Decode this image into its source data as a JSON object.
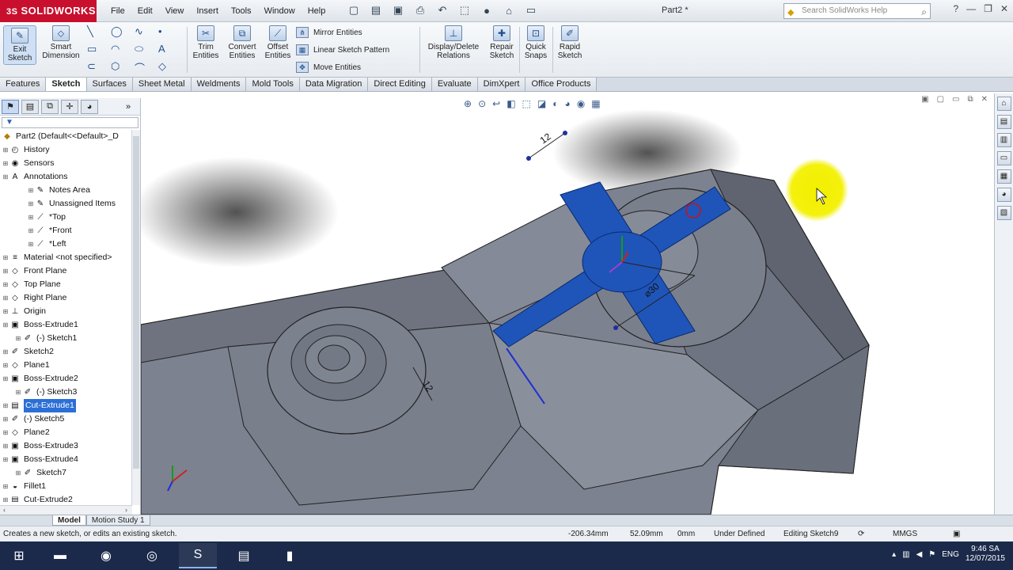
{
  "app": {
    "logo": "SOLIDWORKS",
    "logo_mark": "3S",
    "doc_title": "Part2 *",
    "search_placeholder": "Search SolidWorks Help",
    "menu": [
      "File",
      "Edit",
      "View",
      "Insert",
      "Tools",
      "Window",
      "Help"
    ]
  },
  "commands": {
    "exit_sketch": "Exit Sketch",
    "smart_dimension": "Smart Dimension",
    "trim": "Trim Entities",
    "convert": "Convert Entities",
    "offset": "Offset Entities",
    "mirror": "Mirror Entities",
    "linear_pattern": "Linear Sketch Pattern",
    "move": "Move Entities",
    "relations": "Display/Delete Relations",
    "repair": "Repair Sketch",
    "quick_snaps": "Quick Snaps",
    "rapid_sketch": "Rapid Sketch"
  },
  "tabs": [
    "Features",
    "Sketch",
    "Surfaces",
    "Sheet Metal",
    "Weldments",
    "Mold Tools",
    "Data Migration",
    "Direct Editing",
    "Evaluate",
    "DimXpert",
    "Office Products"
  ],
  "active_tab": "Sketch",
  "tree": {
    "root": "Part2  (Default<<Default>_D",
    "items": [
      {
        "label": "History",
        "indent": 0,
        "icon": "history-icon"
      },
      {
        "label": "Sensors",
        "indent": 0,
        "icon": "sensor-icon"
      },
      {
        "label": "Annotations",
        "indent": 0,
        "icon": "annotation-icon"
      },
      {
        "label": "Notes Area",
        "indent": 2,
        "icon": "notes-icon"
      },
      {
        "label": "Unassigned Items",
        "indent": 2,
        "icon": "notes-icon"
      },
      {
        "label": "*Top",
        "indent": 2,
        "icon": "view-icon"
      },
      {
        "label": "*Front",
        "indent": 2,
        "icon": "view-icon"
      },
      {
        "label": "*Left",
        "indent": 2,
        "icon": "view-icon"
      },
      {
        "label": "Material <not specified>",
        "indent": 0,
        "icon": "material-icon"
      },
      {
        "label": "Front Plane",
        "indent": 0,
        "icon": "plane-icon"
      },
      {
        "label": "Top Plane",
        "indent": 0,
        "icon": "plane-icon"
      },
      {
        "label": "Right Plane",
        "indent": 0,
        "icon": "plane-icon"
      },
      {
        "label": "Origin",
        "indent": 0,
        "icon": "origin-icon"
      },
      {
        "label": "Boss-Extrude1",
        "indent": 0,
        "icon": "extrude-icon"
      },
      {
        "label": "(-) Sketch1",
        "indent": 1,
        "icon": "sketch-icon"
      },
      {
        "label": "Sketch2",
        "indent": 0,
        "icon": "sketch-icon"
      },
      {
        "label": "Plane1",
        "indent": 0,
        "icon": "plane-icon"
      },
      {
        "label": "Boss-Extrude2",
        "indent": 0,
        "icon": "extrude-icon"
      },
      {
        "label": "(-) Sketch3",
        "indent": 1,
        "icon": "sketch-icon"
      },
      {
        "label": "Cut-Extrude1",
        "indent": 0,
        "icon": "cut-icon",
        "selected": true
      },
      {
        "label": "(-) Sketch5",
        "indent": 0,
        "icon": "sketch-icon"
      },
      {
        "label": "Plane2",
        "indent": 0,
        "icon": "plane-icon"
      },
      {
        "label": "Boss-Extrude3",
        "indent": 0,
        "icon": "extrude-icon"
      },
      {
        "label": "Boss-Extrude4",
        "indent": 0,
        "icon": "extrude-icon"
      },
      {
        "label": "Sketch7",
        "indent": 1,
        "icon": "sketch-icon"
      },
      {
        "label": "Fillet1",
        "indent": 0,
        "icon": "fillet-icon"
      },
      {
        "label": "Cut-Extrude2",
        "indent": 0,
        "icon": "cut-icon"
      }
    ]
  },
  "viewport": {
    "dim_top": "12",
    "dim_left": "12",
    "dim_diameter": "⌀30"
  },
  "bottom_tabs": [
    "Model",
    "Motion Study 1"
  ],
  "status": {
    "message": "Creates a new sketch, or edits an existing sketch.",
    "x": "-206.34mm",
    "y": "52.09mm",
    "z": "0mm",
    "state": "Under Defined",
    "editing": "Editing Sketch9",
    "units": "MMGS"
  },
  "taskbar": {
    "lang": "ENG",
    "time": "9:46 SA",
    "date": "12/07/2015"
  }
}
